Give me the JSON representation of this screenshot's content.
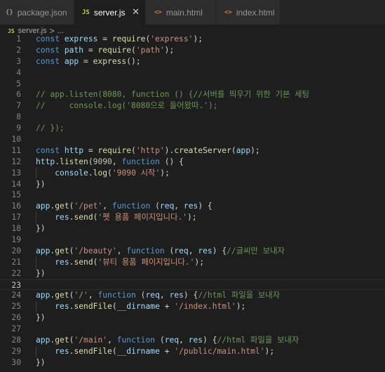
{
  "tabs": [
    {
      "label": "package.json",
      "icon_text": "{}",
      "icon_name": "json-file-icon",
      "color": "#cbcb41",
      "active": false
    },
    {
      "label": "server.js",
      "icon_text": "JS",
      "icon_name": "javascript-file-icon",
      "color": "#cbcb41",
      "active": true
    },
    {
      "label": "main.html",
      "icon_text": "<>",
      "icon_name": "html-file-icon",
      "color": "#e37933",
      "active": false
    },
    {
      "label": "index.html",
      "icon_text": "<>",
      "icon_name": "html-file-icon",
      "color": "#e37933",
      "active": false
    }
  ],
  "breadcrumb": {
    "icon_text": "JS",
    "file": "server.js",
    "separator": ">",
    "rest": "..."
  },
  "current_line": 23,
  "colors": {
    "keyword": "#569cd6",
    "variable": "#9cdcfe",
    "function": "#dcdcaa",
    "string": "#ce9178",
    "number": "#b5cea8",
    "comment": "#6a9955",
    "text": "#d4d4d4"
  },
  "lines": [
    {
      "n": "1",
      "t": [
        [
          "k",
          "const "
        ],
        [
          "v",
          "express"
        ],
        [
          "p",
          " = "
        ],
        [
          "f",
          "require"
        ],
        [
          "p",
          "("
        ],
        [
          "s",
          "'express'"
        ],
        [
          "p",
          ");"
        ]
      ]
    },
    {
      "n": "2",
      "t": [
        [
          "k",
          "const "
        ],
        [
          "v",
          "path"
        ],
        [
          "p",
          " = "
        ],
        [
          "f",
          "require"
        ],
        [
          "p",
          "("
        ],
        [
          "s",
          "'path'"
        ],
        [
          "p",
          ");"
        ]
      ]
    },
    {
      "n": "3",
      "t": [
        [
          "k",
          "const "
        ],
        [
          "v",
          "app"
        ],
        [
          "p",
          " = "
        ],
        [
          "f",
          "express"
        ],
        [
          "p",
          "();"
        ]
      ]
    },
    {
      "n": "4",
      "t": []
    },
    {
      "n": "5",
      "t": []
    },
    {
      "n": "6",
      "t": [
        [
          "c",
          "// app.listen(8080, function () {//서버를 띄우기 위한 기본 세팅"
        ]
      ]
    },
    {
      "n": "7",
      "t": [
        [
          "c",
          "//     console.log('8080으로 들어왔따.');"
        ]
      ]
    },
    {
      "n": "8",
      "t": []
    },
    {
      "n": "9",
      "t": [
        [
          "c",
          "// });"
        ]
      ]
    },
    {
      "n": "10",
      "t": []
    },
    {
      "n": "11",
      "t": [
        [
          "k",
          "const "
        ],
        [
          "v",
          "http"
        ],
        [
          "p",
          " = "
        ],
        [
          "f",
          "require"
        ],
        [
          "p",
          "("
        ],
        [
          "s",
          "'http'"
        ],
        [
          "p",
          ")."
        ],
        [
          "f",
          "createServer"
        ],
        [
          "p",
          "("
        ],
        [
          "v",
          "app"
        ],
        [
          "p",
          ");"
        ]
      ]
    },
    {
      "n": "12",
      "t": [
        [
          "v",
          "http"
        ],
        [
          "p",
          "."
        ],
        [
          "f",
          "listen"
        ],
        [
          "p",
          "("
        ],
        [
          "n",
          "9090"
        ],
        [
          "p",
          ", "
        ],
        [
          "k",
          "function"
        ],
        [
          "p",
          " () {"
        ]
      ]
    },
    {
      "n": "13",
      "t": [
        [
          "p",
          "    "
        ],
        [
          "v",
          "console"
        ],
        [
          "p",
          "."
        ],
        [
          "f",
          "log"
        ],
        [
          "p",
          "("
        ],
        [
          "s",
          "'9090 시작'"
        ],
        [
          "p",
          ");"
        ]
      ]
    },
    {
      "n": "14",
      "t": [
        [
          "p",
          "})"
        ]
      ]
    },
    {
      "n": "15",
      "t": []
    },
    {
      "n": "16",
      "t": [
        [
          "v",
          "app"
        ],
        [
          "p",
          "."
        ],
        [
          "f",
          "get"
        ],
        [
          "p",
          "("
        ],
        [
          "s",
          "'/pet'"
        ],
        [
          "p",
          ", "
        ],
        [
          "k",
          "function"
        ],
        [
          "p",
          " ("
        ],
        [
          "v",
          "req"
        ],
        [
          "p",
          ", "
        ],
        [
          "v",
          "res"
        ],
        [
          "p",
          ") {"
        ]
      ]
    },
    {
      "n": "17",
      "t": [
        [
          "p",
          "    "
        ],
        [
          "v",
          "res"
        ],
        [
          "p",
          "."
        ],
        [
          "f",
          "send"
        ],
        [
          "p",
          "("
        ],
        [
          "s",
          "'펫 용품 페이지입니다.'"
        ],
        [
          "p",
          ");"
        ]
      ]
    },
    {
      "n": "18",
      "t": [
        [
          "p",
          "})"
        ]
      ]
    },
    {
      "n": "19",
      "t": []
    },
    {
      "n": "20",
      "t": [
        [
          "v",
          "app"
        ],
        [
          "p",
          "."
        ],
        [
          "f",
          "get"
        ],
        [
          "p",
          "("
        ],
        [
          "s",
          "'/beauty'"
        ],
        [
          "p",
          ", "
        ],
        [
          "k",
          "function"
        ],
        [
          "p",
          " ("
        ],
        [
          "v",
          "req"
        ],
        [
          "p",
          ", "
        ],
        [
          "v",
          "res"
        ],
        [
          "p",
          ") {"
        ],
        [
          "c",
          "//글씨만 보내자"
        ]
      ]
    },
    {
      "n": "21",
      "t": [
        [
          "p",
          "    "
        ],
        [
          "v",
          "res"
        ],
        [
          "p",
          "."
        ],
        [
          "f",
          "send"
        ],
        [
          "p",
          "("
        ],
        [
          "s",
          "'뷰티 용품 페이지입니다.'"
        ],
        [
          "p",
          ");"
        ]
      ]
    },
    {
      "n": "22",
      "t": [
        [
          "p",
          "})"
        ]
      ]
    },
    {
      "n": "23",
      "t": []
    },
    {
      "n": "24",
      "t": [
        [
          "v",
          "app"
        ],
        [
          "p",
          "."
        ],
        [
          "f",
          "get"
        ],
        [
          "p",
          "("
        ],
        [
          "s",
          "'/'"
        ],
        [
          "p",
          ", "
        ],
        [
          "k",
          "function"
        ],
        [
          "p",
          " ("
        ],
        [
          "v",
          "req"
        ],
        [
          "p",
          ", "
        ],
        [
          "v",
          "res"
        ],
        [
          "p",
          ") {"
        ],
        [
          "c",
          "//html 파일을 보내자"
        ]
      ]
    },
    {
      "n": "25",
      "t": [
        [
          "p",
          "    "
        ],
        [
          "v",
          "res"
        ],
        [
          "p",
          "."
        ],
        [
          "f",
          "sendFile"
        ],
        [
          "p",
          "("
        ],
        [
          "v",
          "__dirname"
        ],
        [
          "p",
          " + "
        ],
        [
          "s",
          "'/index.html'"
        ],
        [
          "p",
          ");"
        ]
      ]
    },
    {
      "n": "26",
      "t": [
        [
          "p",
          "})"
        ]
      ]
    },
    {
      "n": "27",
      "t": []
    },
    {
      "n": "28",
      "t": [
        [
          "v",
          "app"
        ],
        [
          "p",
          "."
        ],
        [
          "f",
          "get"
        ],
        [
          "p",
          "("
        ],
        [
          "s",
          "'/main'"
        ],
        [
          "p",
          ", "
        ],
        [
          "k",
          "function"
        ],
        [
          "p",
          " ("
        ],
        [
          "v",
          "req"
        ],
        [
          "p",
          ", "
        ],
        [
          "v",
          "res"
        ],
        [
          "p",
          ") {"
        ],
        [
          "c",
          "//html 파일을 보내자"
        ]
      ]
    },
    {
      "n": "29",
      "t": [
        [
          "p",
          "    "
        ],
        [
          "v",
          "res"
        ],
        [
          "p",
          "."
        ],
        [
          "f",
          "sendFile"
        ],
        [
          "p",
          "("
        ],
        [
          "v",
          "__dirname"
        ],
        [
          "p",
          " + "
        ],
        [
          "s",
          "'/public/main.html'"
        ],
        [
          "p",
          ");"
        ]
      ]
    },
    {
      "n": "30",
      "t": [
        [
          "p",
          "})"
        ]
      ]
    }
  ]
}
